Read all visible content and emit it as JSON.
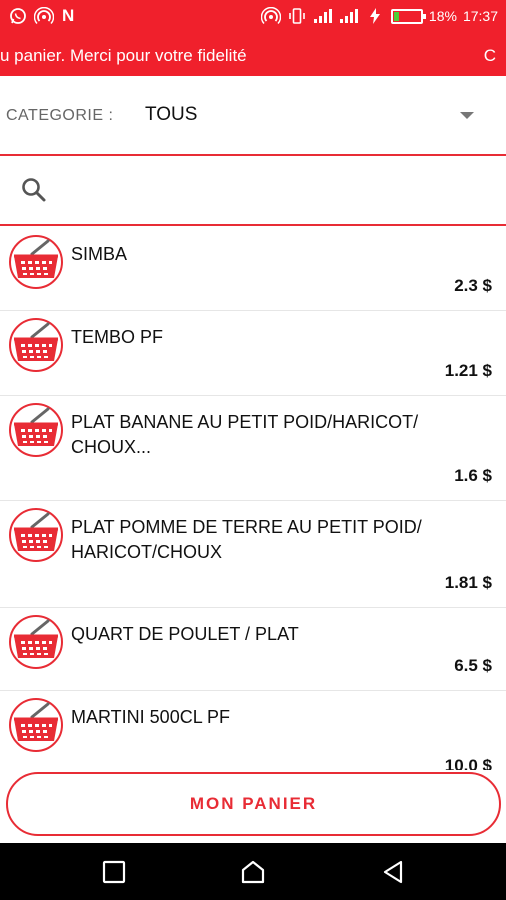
{
  "status_bar": {
    "left_icons": [
      "whatsapp-icon",
      "wifi-hotspot-icon",
      "n-icon"
    ],
    "n_label": "N",
    "battery_percent": "18%",
    "battery_level": 0.18,
    "time": "17:37",
    "colors": {
      "background": "#f0202c"
    }
  },
  "banner": {
    "text": "u panier. Merci pour votre fidelité",
    "tail": "C"
  },
  "category": {
    "label": "CATEGORIE :",
    "value": "TOUS"
  },
  "search": {
    "value": "",
    "placeholder": ""
  },
  "products": [
    {
      "name": "SIMBA",
      "price": "2.3 $"
    },
    {
      "name": "TEMBO PF",
      "price": "1.21 $"
    },
    {
      "name": "PLAT BANANE AU PETIT POID/HARICOT/\nCHOUX...",
      "price": "1.6 $"
    },
    {
      "name": "PLAT POMME DE TERRE AU PETIT POID/\nHARICOT/CHOUX",
      "price": "1.81 $"
    },
    {
      "name": "QUART DE POULET / PLAT",
      "price": "6.5 $"
    },
    {
      "name": "MARTINI 500CL PF",
      "price": "10.0 $"
    }
  ],
  "cart_button": {
    "label": "MON PANIER"
  },
  "colors": {
    "accent": "#e82c35",
    "brand": "#f0202c"
  }
}
